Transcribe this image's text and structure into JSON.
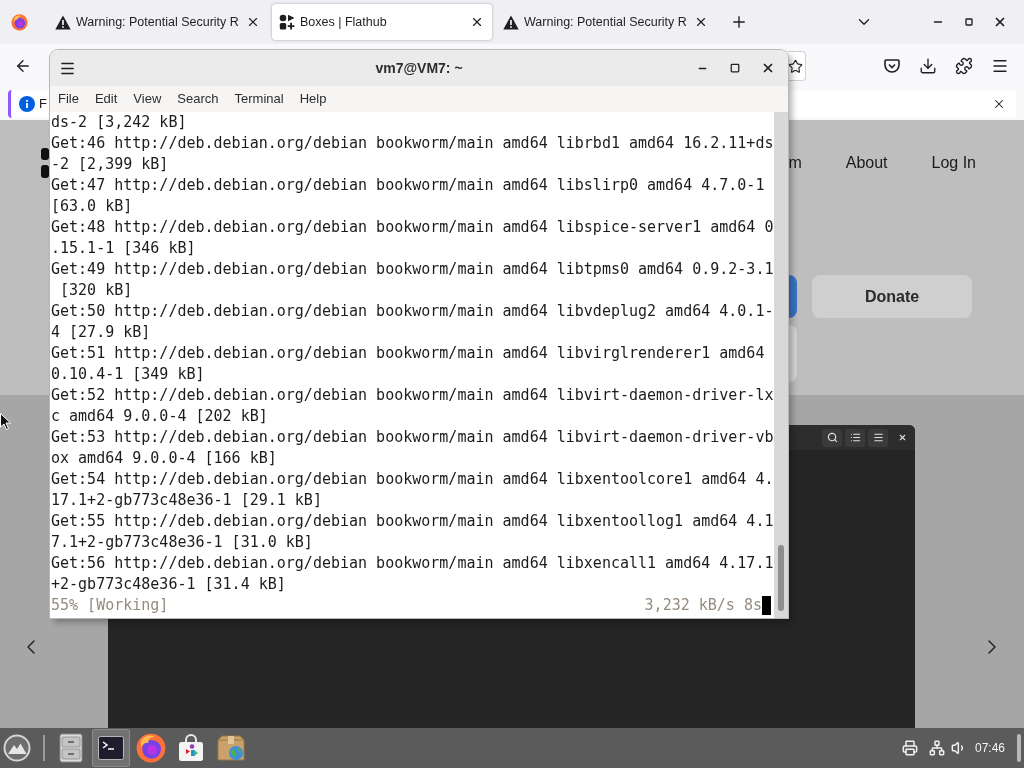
{
  "browser": {
    "tabs": [
      {
        "kind": "warning",
        "title": "Warning: Potential Security R",
        "selected": false
      },
      {
        "kind": "site",
        "title": "Boxes | Flathub",
        "selected": true
      },
      {
        "kind": "warning",
        "title": "Warning: Potential Security R",
        "selected": false
      }
    ],
    "notification": {
      "text": "F"
    }
  },
  "page": {
    "nav_links": [
      "m",
      "About",
      "Log In"
    ],
    "donate_button": "Donate"
  },
  "terminal": {
    "title": "vm7@VM7: ~",
    "menu": [
      "File",
      "Edit",
      "View",
      "Search",
      "Terminal",
      "Help"
    ],
    "lines": [
      "ds-2 [3,242 kB]",
      "Get:46 http://deb.debian.org/debian bookworm/main amd64 librbd1 amd64 16.2.11+ds",
      "-2 [2,399 kB]",
      "Get:47 http://deb.debian.org/debian bookworm/main amd64 libslirp0 amd64 4.7.0-1",
      "[63.0 kB]",
      "Get:48 http://deb.debian.org/debian bookworm/main amd64 libspice-server1 amd64 0",
      ".15.1-1 [346 kB]",
      "Get:49 http://deb.debian.org/debian bookworm/main amd64 libtpms0 amd64 0.9.2-3.1",
      " [320 kB]",
      "Get:50 http://deb.debian.org/debian bookworm/main amd64 libvdeplug2 amd64 4.0.1-",
      "4 [27.9 kB]",
      "Get:51 http://deb.debian.org/debian bookworm/main amd64 libvirglrenderer1 amd64",
      "0.10.4-1 [349 kB]",
      "Get:52 http://deb.debian.org/debian bookworm/main amd64 libvirt-daemon-driver-lx",
      "c amd64 9.0.0-4 [202 kB]",
      "Get:53 http://deb.debian.org/debian bookworm/main amd64 libvirt-daemon-driver-vb",
      "ox amd64 9.0.0-4 [166 kB]",
      "Get:54 http://deb.debian.org/debian bookworm/main amd64 libxentoolcore1 amd64 4.",
      "17.1+2-gb773c48e36-1 [29.1 kB]",
      "Get:55 http://deb.debian.org/debian bookworm/main amd64 libxentoollog1 amd64 4.1",
      "7.1+2-gb773c48e36-1 [31.0 kB]",
      "Get:56 http://deb.debian.org/debian bookworm/main amd64 libxencall1 amd64 4.17.1",
      "+2-gb773c48e36-1 [31.4 kB]"
    ],
    "status": {
      "progress": "55% [Working]",
      "speed": "3,232 kB/s 8s"
    }
  },
  "taskbar": {
    "apps": [
      {
        "kind": "files",
        "active": false
      },
      {
        "kind": "terminal",
        "active": true
      },
      {
        "kind": "browser",
        "active": false
      },
      {
        "kind": "store",
        "active": false
      },
      {
        "kind": "package",
        "active": false
      }
    ],
    "clock": "07:46"
  }
}
